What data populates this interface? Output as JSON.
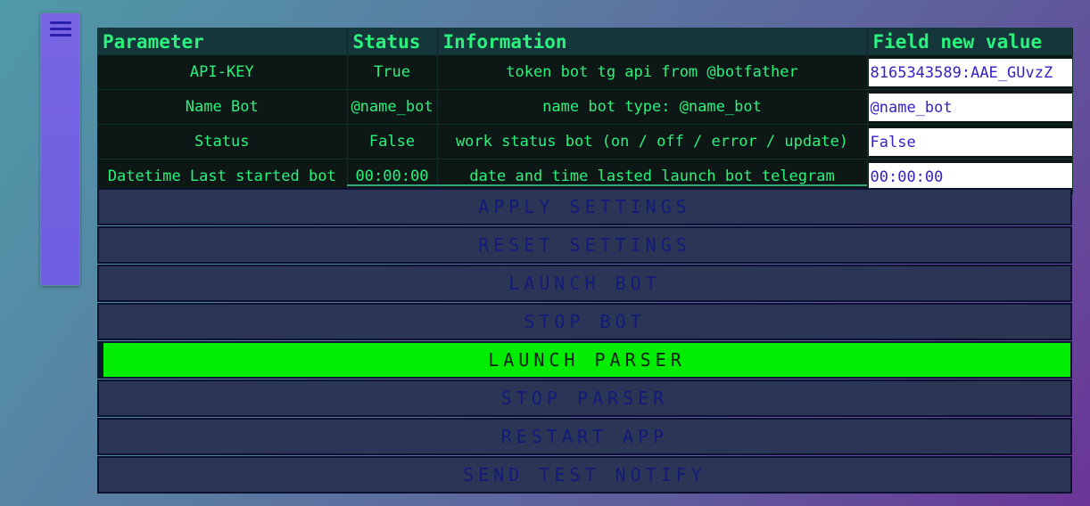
{
  "table": {
    "headers": [
      "Parameter",
      "Status",
      "Information",
      "Field new value"
    ],
    "rows": [
      {
        "parameter": "API-KEY",
        "status": "True",
        "information": "token bot tg api from @botfather",
        "value": "8165343589:AAE_GUvzZ"
      },
      {
        "parameter": "Name Bot",
        "status": "@name_bot",
        "information": "name bot type: @name_bot",
        "value": "@name_bot"
      },
      {
        "parameter": "Status",
        "status": "False",
        "information": "work status bot (on / off / error / update)",
        "value": "False"
      },
      {
        "parameter": "Datetime Last started bot",
        "status": "00:00:00",
        "information": "date and time lasted launch bot telegram",
        "value": "00:00:00"
      }
    ]
  },
  "buttons": {
    "apply": "APPLY SETTINGS",
    "reset": "RESET SETTINGS",
    "launch_bot": "LAUNCH BOT",
    "stop_bot": "STOP BOT",
    "launch_parser": "LAUNCH PARSER",
    "stop_parser": "STOP PARSER",
    "restart_app": "RESTART APP",
    "send_test_notify": "SEND TEST NOTIFY"
  },
  "icons": {
    "menu": "hamburger-menu-icon"
  },
  "colors": {
    "accent_green": "#2af27d",
    "active_button": "#00ec00",
    "button_bg": "#2b3556",
    "button_text": "#151a7a",
    "side_tab": "#7765e3"
  }
}
